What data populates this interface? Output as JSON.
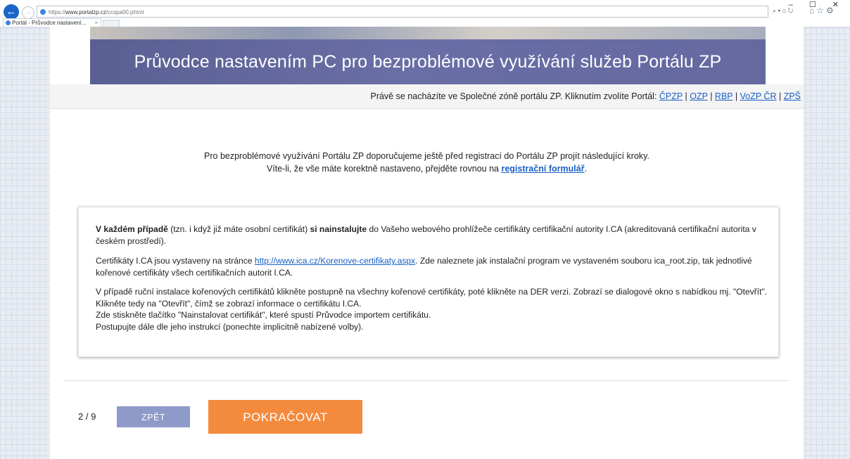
{
  "browser": {
    "url_protocol": "https://",
    "url_host": "www.portalzp.cz",
    "url_path": "/ccspa00.phtml",
    "address_tools": "⌕ ▾ ⌂ ↻",
    "tab_title": "Portál - Průvodce nastavení...",
    "window_controls": "– ☐ ✕"
  },
  "banner": {
    "title": "Průvodce nastavením PC pro bezproblémové využívání služeb Portálu ZP"
  },
  "zone": {
    "text": "Právě se nacházíte ve Společné zóně portálu ZP. Kliknutím zvolíte Portál: ",
    "links": [
      "ČPZP",
      "OZP",
      "RBP",
      "VoZP ČR",
      "ZPŠ"
    ],
    "separator": " | "
  },
  "intro": {
    "line1": "Pro bezproblémové využívání Portálu ZP doporučujeme ještě před registrací do Portálu ZP projít následující kroky.",
    "line2_prefix": "Víte-li, že vše máte korektně nastaveno, přejděte rovnou na ",
    "line2_link": "registrační formulář",
    "line2_suffix": "."
  },
  "card": {
    "p1_bold1": "V každém případě",
    "p1_text1": " (tzn. i když již máte osobní certifikát) ",
    "p1_bold2": "si nainstalujte",
    "p1_text2": " do Vašeho webového prohlížeče certifikáty certifikační autority I.CA (akreditovaná certifikační autorita v českém prostředí).",
    "p2_text1": "Certifikáty I.CA jsou vystaveny na stránce ",
    "p2_link": "http://www.ica.cz/Korenove-certifikaty.aspx",
    "p2_text2": ". Zde naleznete jak instalační program ve vystaveném souboru ica_root.zip, tak jednotlivé kořenové certifikáty všech certifikačních autorit I.CA.",
    "p3_line1": "V případě ruční instalace kořenových certifikátů klikněte postupně na všechny kořenové certifikáty, poté klikněte na DER verzi. Zobrazí se dialogové okno s nabídkou mj. \"Otevřít\". Klikněte tedy na \"Otevřít\", čímž se zobrazí informace o certifikátu I.CA.",
    "p3_line2": "Zde stiskněte tlačítko \"Nainstalovat certifikát\", které spustí Průvodce importem certifikátu.",
    "p3_line3": "Postupujte dále dle jeho instrukcí (ponechte implicitně nabízené volby)."
  },
  "footer": {
    "pager": "2 / 9",
    "back_label": "ZPĚT",
    "next_label": "POKRAČOVAT"
  },
  "colors": {
    "banner": "#6569a0",
    "link": "#1a5fc4",
    "back_button": "#8e9ac8",
    "next_button": "#f48a3c"
  }
}
